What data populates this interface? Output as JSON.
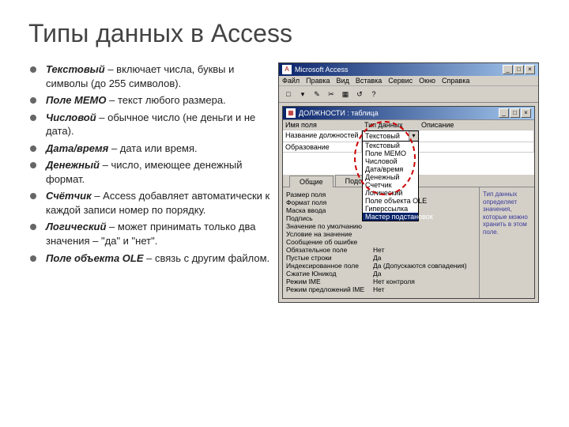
{
  "slide": {
    "title": "Типы данных в Access",
    "items": [
      {
        "term": "Текстовый",
        "desc": " – включает числа, буквы и символы (до 255 символов)."
      },
      {
        "term": "Поле МЕМО",
        "desc": " – текст любого размера."
      },
      {
        "term": "Числовой",
        "desc": " – обычное число (не деньги и не дата)."
      },
      {
        "term": "Дата/время",
        "desc": " – дата или время."
      },
      {
        "term": "Денежный",
        "desc": " – число, имеющее денежный формат."
      },
      {
        "term": "Счётчик",
        "desc": " – Access добавляет автоматически к каждой записи номер по порядку."
      },
      {
        "term": "Логический",
        "desc": " – может принимать только два значения – \"да\" и \"нет\"."
      },
      {
        "term": "Поле объекта OLE",
        "desc": " – связь с другим файлом."
      }
    ]
  },
  "app": {
    "title": "Microsoft Access",
    "menu": [
      "Файл",
      "Правка",
      "Вид",
      "Вставка",
      "Сервис",
      "Окно",
      "Справка"
    ],
    "subwin_title": "ДОЛЖНОСТИ : таблица",
    "grid": {
      "headers": [
        "Имя поля",
        "Тип данных",
        "Описание"
      ],
      "rows": [
        {
          "name": "Название должностей",
          "type": "Текстовый"
        },
        {
          "name": "Образование",
          "type": ""
        }
      ]
    },
    "dropdown": [
      "Текстовый",
      "Поле МЕМО",
      "Числовой",
      "Дата/время",
      "Денежный",
      "Счетчик",
      "Логический",
      "Поле объекта OLE",
      "Гиперссылка",
      "Мастер подстановок"
    ],
    "dropdown_selected": "Мастер подстаново…",
    "tabs": [
      "Общие",
      "Подстановка"
    ],
    "props": [
      {
        "label": "Размер поля",
        "value": ""
      },
      {
        "label": "Формат поля",
        "value": ""
      },
      {
        "label": "Маска ввода",
        "value": ""
      },
      {
        "label": "Подпись",
        "value": ""
      },
      {
        "label": "Значение по умолчанию",
        "value": ""
      },
      {
        "label": "Условие на значение",
        "value": ""
      },
      {
        "label": "Сообщение об ошибке",
        "value": ""
      },
      {
        "label": "Обязательное поле",
        "value": "Нет"
      },
      {
        "label": "Пустые строки",
        "value": "Да"
      },
      {
        "label": "Индексированное поле",
        "value": "Да (Допускаются совпадения)"
      },
      {
        "label": "Сжатие Юникод",
        "value": "Да"
      },
      {
        "label": "Режим IME",
        "value": "Нет контроля"
      },
      {
        "label": "Режим предложений IME",
        "value": "Нет"
      }
    ],
    "help_text": "Тип данных определяет значения, которые можно хранить в этом поле."
  }
}
